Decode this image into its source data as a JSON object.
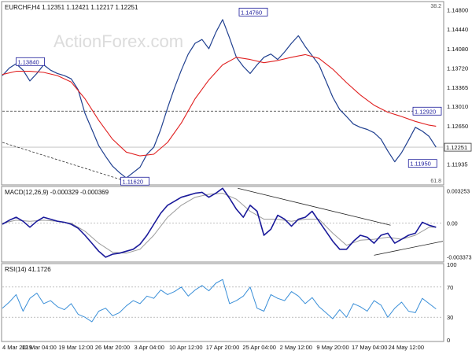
{
  "watermark": "ActionForex.com",
  "chart_data": [
    {
      "type": "line",
      "panel": "price",
      "title": "EURCHF,H4  1.12351 1.12421 1.12217 1.12251",
      "ylim": [
        1.1158,
        1.1494
      ],
      "y_ticks": [
        "1.14800",
        "1.14440",
        "1.14080",
        "1.13720",
        "1.13365",
        "1.13010",
        "1.12650",
        "1.12295",
        "1.11935"
      ],
      "corner_labels": {
        "top": "38.2",
        "bottom": "61.8"
      },
      "current_price": "1.12251",
      "level_labels": [
        {
          "text": "1.14760",
          "x": 17.2,
          "y": 1.1476
        },
        {
          "text": "1.13840",
          "x": 1.0,
          "y": 1.1384
        },
        {
          "text": "1.11620",
          "x": 8.6,
          "y": 1.1162
        },
        {
          "text": "1.11950",
          "x": 29.5,
          "y": 1.1195
        },
        {
          "text": "1.12920",
          "x": 31.8,
          "y": 1.1292
        }
      ],
      "horizontal_lines": [
        {
          "y": 1.1292,
          "style": "dashed"
        },
        {
          "y": 1.12251,
          "style": "solid"
        }
      ],
      "trend_line": {
        "x": [
          0,
          8.6
        ],
        "y": [
          1.1234,
          1.1165
        ],
        "style": "dashed"
      },
      "series": [
        {
          "role": "close",
          "color": "#1f3f8f",
          "x": [
            0,
            0.5,
            1,
            1.5,
            2,
            2.5,
            3,
            3.5,
            4,
            4.5,
            5,
            5.5,
            6,
            6.5,
            7,
            7.5,
            8,
            8.5,
            9,
            9.5,
            10,
            10.5,
            11,
            11.5,
            12,
            12.5,
            13,
            13.5,
            14,
            14.5,
            15,
            15.5,
            16,
            16.5,
            17,
            17.5,
            18,
            18.5,
            19,
            19.5,
            20,
            20.5,
            21,
            21.5,
            22,
            22.5,
            23,
            23.5,
            24,
            24.5,
            25,
            25.5,
            26,
            26.5,
            27,
            27.5,
            28,
            28.5,
            29,
            29.5,
            30,
            30.5,
            31,
            31.5
          ],
          "y": [
            1.1358,
            1.1372,
            1.138,
            1.1368,
            1.1348,
            1.1362,
            1.1378,
            1.1368,
            1.1362,
            1.1358,
            1.1352,
            1.1332,
            1.1288,
            1.1258,
            1.1228,
            1.1208,
            1.119,
            1.1178,
            1.1168,
            1.1178,
            1.1188,
            1.1212,
            1.1225,
            1.1258,
            1.1298,
            1.1335,
            1.1368,
            1.1398,
            1.1418,
            1.1425,
            1.1408,
            1.1438,
            1.1462,
            1.1428,
            1.1392,
            1.1375,
            1.1362,
            1.1378,
            1.1392,
            1.1398,
            1.1388,
            1.1402,
            1.1418,
            1.1432,
            1.1412,
            1.1395,
            1.1378,
            1.1348,
            1.1318,
            1.1295,
            1.1282,
            1.1268,
            1.1262,
            1.1258,
            1.1252,
            1.124,
            1.1218,
            1.1198,
            1.1215,
            1.1238,
            1.1262,
            1.1255,
            1.1245,
            1.1225
          ]
        },
        {
          "role": "moving-average",
          "color": "#e02020",
          "x": [
            0,
            1,
            2,
            3,
            4,
            5,
            6,
            7,
            8,
            9,
            10,
            11,
            12,
            13,
            14,
            15,
            16,
            17,
            18,
            19,
            20,
            21,
            22,
            23,
            24,
            25,
            26,
            27,
            28,
            29,
            30,
            31,
            31.5
          ],
          "y": [
            1.136,
            1.1366,
            1.1366,
            1.1364,
            1.1358,
            1.1346,
            1.1315,
            1.1275,
            1.124,
            1.1216,
            1.1209,
            1.1212,
            1.1234,
            1.127,
            1.1315,
            1.135,
            1.1378,
            1.1392,
            1.1388,
            1.1382,
            1.1386,
            1.1392,
            1.1397,
            1.139,
            1.137,
            1.1345,
            1.1322,
            1.1303,
            1.129,
            1.1282,
            1.1273,
            1.1266,
            1.1264
          ]
        }
      ]
    },
    {
      "type": "line",
      "panel": "macd",
      "title": "MACD(12,26,9) -0.000329 -0.000369",
      "ylim": [
        -0.0038,
        0.0036
      ],
      "y_ticks": [
        "0.003253",
        "0.00",
        "-0.003373"
      ],
      "series": [
        {
          "role": "macd",
          "color": "#1a1a9a",
          "x": [
            0,
            0.5,
            1,
            1.5,
            2,
            2.5,
            3,
            3.5,
            4,
            4.5,
            5,
            5.5,
            6,
            6.5,
            7,
            7.5,
            8,
            8.5,
            9,
            9.5,
            10,
            10.5,
            11,
            11.5,
            12,
            12.5,
            13,
            13.5,
            14,
            14.5,
            15,
            15.5,
            16,
            16.5,
            17,
            17.5,
            18,
            18.5,
            19,
            19.5,
            20,
            20.5,
            21,
            21.5,
            22,
            22.5,
            23,
            23.5,
            24,
            24.5,
            25,
            25.5,
            26,
            26.5,
            27,
            27.5,
            28,
            28.5,
            29,
            29.5,
            30,
            30.5,
            31,
            31.5
          ],
          "y": [
            -0.0001,
            0.0003,
            0.0006,
            0.0002,
            -0.0004,
            0.0002,
            0.0006,
            0.0004,
            0.0002,
            0.0001,
            -0.0001,
            -0.0005,
            -0.0012,
            -0.002,
            -0.0028,
            -0.0034,
            -0.0031,
            -0.003,
            -0.0028,
            -0.0026,
            -0.0021,
            -0.0012,
            -0.0001,
            0.001,
            0.0018,
            0.0022,
            0.0026,
            0.0028,
            0.003,
            0.0031,
            0.0026,
            0.003,
            0.0035,
            0.0025,
            0.0014,
            0.0006,
            0.0018,
            0.0012,
            -0.0012,
            -0.0006,
            0.0008,
            0.0004,
            -0.0003,
            0.0004,
            0.0006,
            0.0012,
            0.0002,
            -0.0008,
            -0.0018,
            -0.0026,
            -0.0026,
            -0.0018,
            -0.0012,
            -0.0014,
            -0.002,
            -0.0012,
            -0.001,
            -0.002,
            -0.0016,
            -0.0012,
            -0.001,
            0.0001,
            -0.0002,
            -0.0004
          ]
        },
        {
          "role": "signal",
          "color": "#9a9a9a",
          "x": [
            0,
            1,
            2,
            3,
            4,
            5,
            6,
            7,
            8,
            9,
            10,
            11,
            12,
            13,
            14,
            15,
            16,
            17,
            18,
            19,
            20,
            21,
            22,
            23,
            24,
            25,
            26,
            27,
            28,
            29,
            30,
            31,
            31.5
          ],
          "y": [
            0.0,
            0.0003,
            0.0002,
            0.0003,
            0.0002,
            0.0,
            -0.0008,
            -0.002,
            -0.0029,
            -0.003,
            -0.0026,
            -0.0012,
            0.0006,
            0.0018,
            0.0026,
            0.0029,
            0.003,
            0.0024,
            0.0012,
            0.0004,
            0.0004,
            0.0002,
            0.0004,
            0.0004,
            -0.001,
            -0.0022,
            -0.0017,
            -0.0016,
            -0.0014,
            -0.0016,
            -0.0012,
            -0.0004,
            -0.0004
          ]
        }
      ],
      "trend_lines": [
        {
          "x": [
            17.1,
            28.2
          ],
          "y": [
            0.0035,
            -0.0002
          ]
        },
        {
          "x": [
            27.0,
            32.0
          ],
          "y": [
            -0.0032,
            -0.0018
          ]
        }
      ]
    },
    {
      "type": "line",
      "panel": "rsi",
      "title": "RSI(14) 41.1726",
      "ylim": [
        0,
        100
      ],
      "y_ticks": [
        "100",
        "70",
        "30",
        "0"
      ],
      "levels": [
        70,
        30
      ],
      "series": [
        {
          "role": "rsi",
          "color": "#3a8fd8",
          "x": [
            0,
            0.5,
            1,
            1.5,
            2,
            2.5,
            3,
            3.5,
            4,
            4.5,
            5,
            5.5,
            6,
            6.5,
            7,
            7.5,
            8,
            8.5,
            9,
            9.5,
            10,
            10.5,
            11,
            11.5,
            12,
            12.5,
            13,
            13.5,
            14,
            14.5,
            15,
            15.5,
            16,
            16.5,
            17,
            17.5,
            18,
            18.5,
            19,
            19.5,
            20,
            20.5,
            21,
            21.5,
            22,
            22.5,
            23,
            23.5,
            24,
            24.5,
            25,
            25.5,
            26,
            26.5,
            27,
            27.5,
            28,
            28.5,
            29,
            29.5,
            30,
            30.5,
            31,
            31.5
          ],
          "y": [
            42,
            50,
            60,
            38,
            55,
            62,
            48,
            52,
            44,
            40,
            48,
            34,
            30,
            24,
            38,
            42,
            32,
            36,
            45,
            52,
            48,
            58,
            55,
            66,
            60,
            64,
            70,
            58,
            66,
            72,
            65,
            75,
            80,
            48,
            52,
            58,
            70,
            42,
            38,
            60,
            55,
            52,
            64,
            58,
            48,
            56,
            44,
            36,
            28,
            40,
            30,
            48,
            44,
            38,
            52,
            46,
            30,
            42,
            50,
            38,
            36,
            55,
            48,
            41
          ]
        }
      ]
    }
  ],
  "x_axis": {
    "labels": [
      "4 Mar 2019",
      "12 Mar 04:00",
      "19 Mar 12:00",
      "26 Mar 20:00",
      "3 Apr 04:00",
      "10 Apr 12:00",
      "17 Apr 20:00",
      "25 Apr 04:00",
      "2 May 12:00",
      "9 May 20:00",
      "17 May 04:00",
      "24 May 12:00"
    ]
  }
}
